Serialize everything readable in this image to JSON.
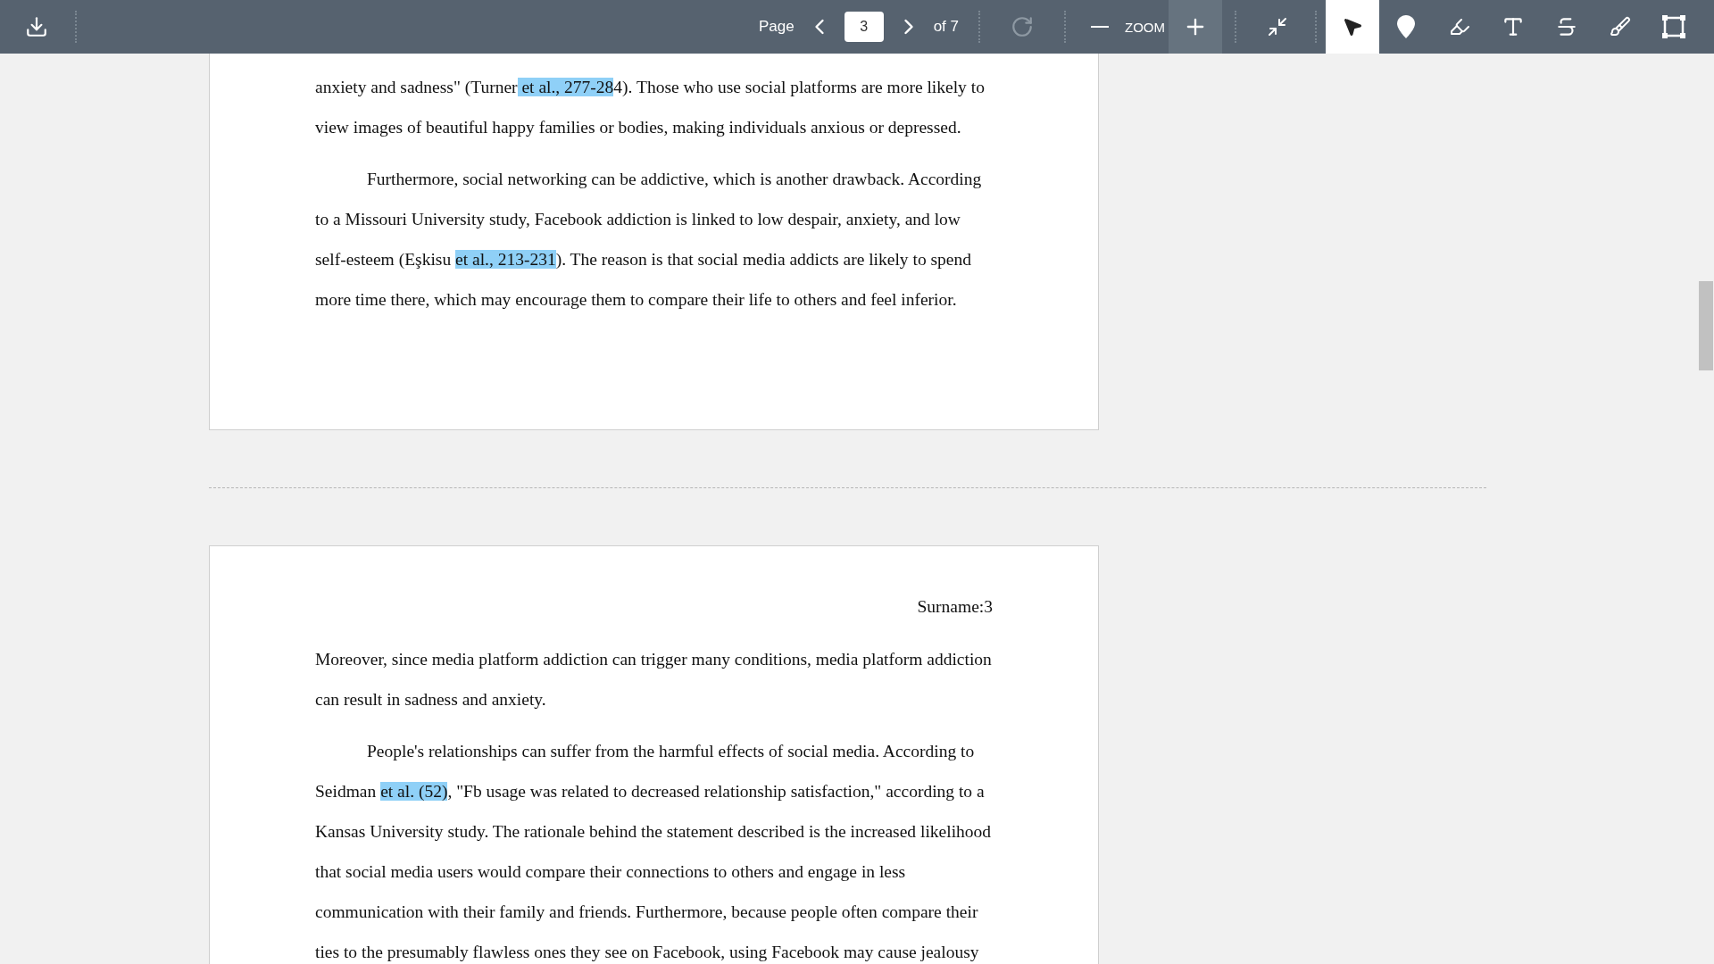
{
  "toolbar": {
    "page_label": "Page",
    "page_value": "3",
    "page_total": "of 7",
    "zoom_label": "ZOOM",
    "tools": [
      {
        "kind": "select",
        "selected": true
      },
      {
        "kind": "pin",
        "selected": false
      },
      {
        "kind": "pen",
        "selected": false
      },
      {
        "kind": "text",
        "selected": false
      },
      {
        "kind": "strike",
        "selected": false
      },
      {
        "kind": "brush",
        "selected": false
      },
      {
        "kind": "area",
        "selected": false
      }
    ]
  },
  "pages": [
    {
      "paragraphs": [
        {
          "indented": false,
          "lines": [
            [
              {
                "text": "anxiety and sadness\" (Turner",
                "highlighted": false
              },
              {
                "text": " et al., 277-28",
                "highlighted": true
              },
              {
                "text": "4). Those who use social platforms are more likely to",
                "highlighted": false
              }
            ],
            [
              {
                "text": "view images of beautiful happy families or bodies, making individuals anxious or depressed.",
                "highlighted": false
              }
            ]
          ]
        },
        {
          "indented": true,
          "lines": [
            [
              {
                "text": "Furthermore, social networking can be addictive, which is another drawback. According",
                "highlighted": false
              }
            ],
            [
              {
                "text": "to a Missouri University study, Facebook addiction is linked to low despair, anxiety, and low",
                "highlighted": false
              }
            ],
            [
              {
                "text": "self-esteem (Eşkisu ",
                "highlighted": false
              },
              {
                "text": "et al., 213-231",
                "highlighted": true
              },
              {
                "text": "). The reason is that social media addicts are likely to spend",
                "highlighted": false
              }
            ],
            [
              {
                "text": "more time there, which may encourage them to compare their life to others and feel inferior.",
                "highlighted": false
              }
            ]
          ]
        }
      ]
    },
    {
      "header": "Surname:3",
      "paragraphs": [
        {
          "indented": false,
          "lines": [
            [
              {
                "text": "Moreover, since media platform addiction can trigger many conditions, media platform addiction",
                "highlighted": false
              }
            ],
            [
              {
                "text": "can result in sadness and anxiety.",
                "highlighted": false
              }
            ]
          ]
        },
        {
          "indented": true,
          "lines": [
            [
              {
                "text": "People's relationships can suffer from the harmful effects of social media. According to",
                "highlighted": false
              }
            ],
            [
              {
                "text": "Seidman ",
                "highlighted": false
              },
              {
                "text": "et al. (52)",
                "highlighted": true
              },
              {
                "text": ", \"Fb usage was related to decreased relationship satisfaction,\" according to a",
                "highlighted": false
              }
            ],
            [
              {
                "text": "Kansas University study. The rationale behind the statement described is the increased likelihood",
                "highlighted": false
              }
            ],
            [
              {
                "text": "that social media users would compare their connections to others and engage in less",
                "highlighted": false
              }
            ],
            [
              {
                "text": "communication with their family and friends. Furthermore, because people often compare their",
                "highlighted": false
              }
            ],
            [
              {
                "text": "ties to the presumably flawless ones they see on Facebook, using Facebook may cause jealousy",
                "highlighted": false
              }
            ]
          ]
        }
      ]
    }
  ]
}
